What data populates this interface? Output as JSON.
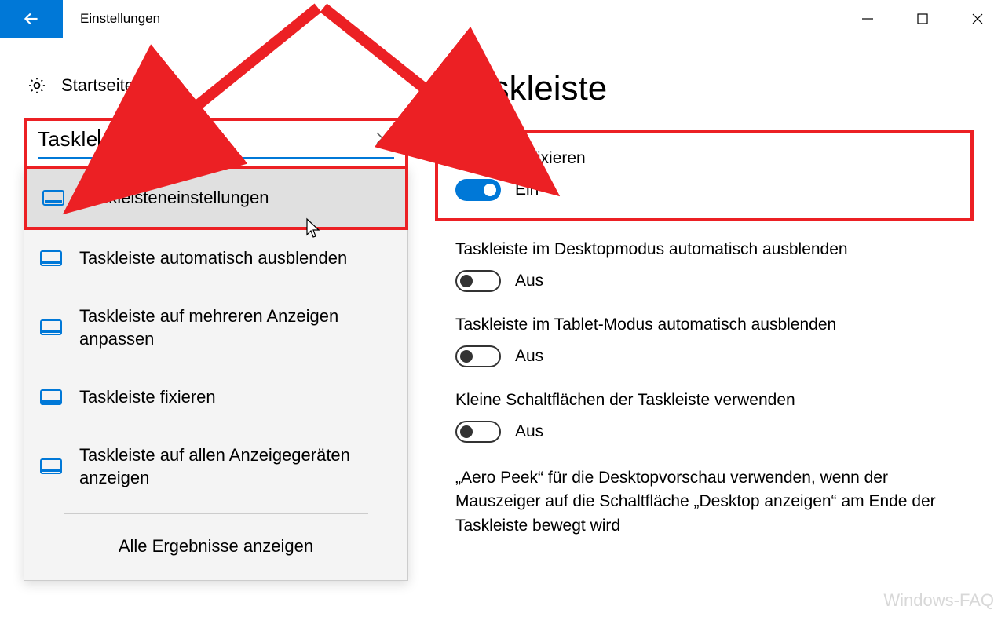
{
  "window": {
    "title": "Einstellungen"
  },
  "sidebar": {
    "home_label": "Startseite",
    "search_value": "Taskle",
    "results": [
      {
        "label": "Taskleisteneinstellungen"
      },
      {
        "label": "Taskleiste automatisch ausblenden"
      },
      {
        "label": "Taskleiste auf mehreren Anzeigen anpassen"
      },
      {
        "label": "Taskleiste fixieren"
      },
      {
        "label": "Taskleiste auf allen Anzeigegeräten anzeigen"
      }
    ],
    "all_results_label": "Alle Ergebnisse anzeigen"
  },
  "main": {
    "heading": "Taskleiste",
    "settings": [
      {
        "label": "Taskleiste fixieren",
        "on": true,
        "state": "Ein"
      },
      {
        "label": "Taskleiste im Desktopmodus automatisch ausblenden",
        "on": false,
        "state": "Aus"
      },
      {
        "label": "Taskleiste im Tablet-Modus automatisch ausblenden",
        "on": false,
        "state": "Aus"
      },
      {
        "label": "Kleine Schaltflächen der Taskleiste verwenden",
        "on": false,
        "state": "Aus"
      }
    ],
    "aero_peek_text": "„Aero Peek“ für die Desktopvorschau verwenden, wenn der Mauszeiger auf die Schaltfläche „Desktop anzeigen“ am Ende der Taskleiste bewegt wird"
  },
  "watermark": "Windows-FAQ"
}
